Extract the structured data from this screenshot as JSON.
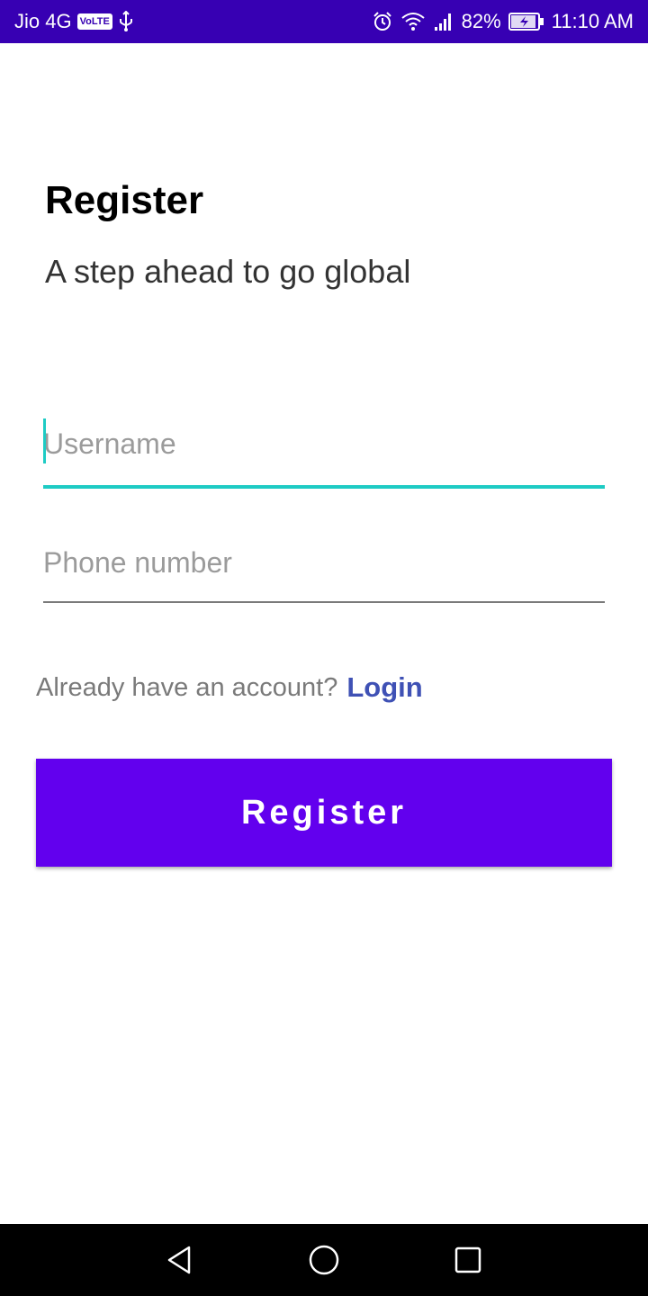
{
  "status_bar": {
    "carrier": "Jio 4G",
    "volte": "VoLTE",
    "battery": "82%",
    "time": "11:10 AM",
    "icons": [
      "usb-icon",
      "alarm-icon",
      "wifi-icon",
      "signal-icon",
      "battery-charging-icon"
    ],
    "background": "#3700B3"
  },
  "page": {
    "title": "Register",
    "subtitle": "A step ahead to go global"
  },
  "form": {
    "username_placeholder": "Username",
    "phone_placeholder": "Phone number",
    "focused_field": "username",
    "accent": "#1ECBC4"
  },
  "login_prompt": {
    "question": "Already have an account?",
    "link": "Login",
    "link_color": "#3F51B5"
  },
  "register_button": {
    "label": "Register",
    "color": "#6200EE"
  },
  "nav_bar": {
    "icons": [
      "back-icon",
      "home-icon",
      "recents-icon"
    ]
  }
}
